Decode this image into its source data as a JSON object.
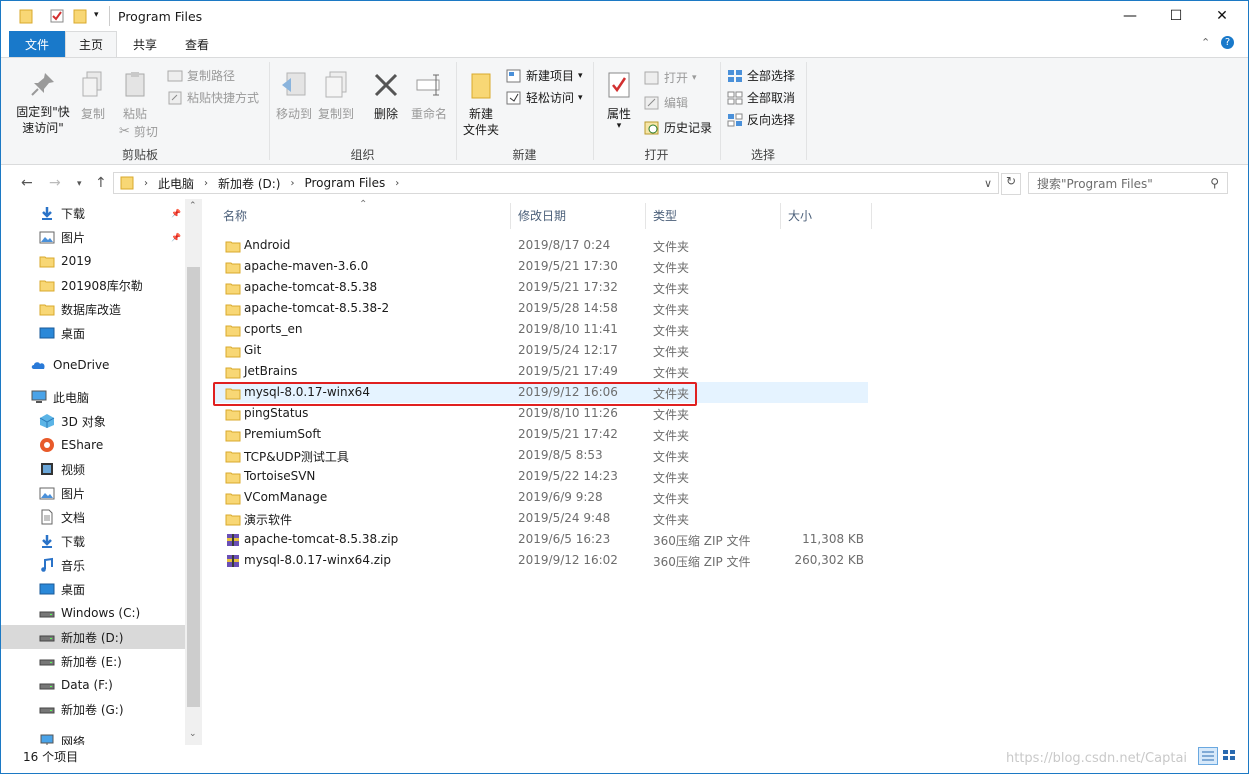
{
  "window": {
    "title": "Program Files",
    "minimize": "—",
    "maximize": "☐",
    "close": "✕"
  },
  "ribbon_tabs": {
    "file": "文件",
    "home": "主页",
    "share": "共享",
    "view": "查看"
  },
  "ribbon": {
    "clipboard": {
      "label": "剪贴板",
      "pin_line1": "固定到\"快",
      "pin_line2": "速访问\"",
      "copy": "复制",
      "paste": "粘贴",
      "cut": "剪切",
      "copy_path": "复制路径",
      "paste_shortcut": "粘贴快捷方式"
    },
    "organize": {
      "label": "组织",
      "move_to": "移动到",
      "copy_to": "复制到",
      "delete": "删除",
      "rename": "重命名"
    },
    "new": {
      "label": "新建",
      "new_folder_line1": "新建",
      "new_folder_line2": "文件夹",
      "new_item": "新建项目",
      "easy_access": "轻松访问"
    },
    "open": {
      "label": "打开",
      "properties": "属性",
      "open": "打开",
      "edit": "编辑",
      "history": "历史记录"
    },
    "select": {
      "label": "选择",
      "select_all": "全部选择",
      "select_none": "全部取消",
      "invert": "反向选择"
    }
  },
  "address": {
    "crumbs": [
      "此电脑",
      "新加卷 (D:)",
      "Program Files"
    ],
    "search_placeholder": "搜索\"Program Files\""
  },
  "nav": {
    "items": [
      {
        "label": "下载",
        "icon": "download-arrow-icon",
        "pinned": true
      },
      {
        "label": "图片",
        "icon": "pictures-icon",
        "pinned": true
      },
      {
        "label": "2019",
        "icon": "folder-icon",
        "pinned": false
      },
      {
        "label": "201908库尔勒",
        "icon": "folder-icon",
        "pinned": false
      },
      {
        "label": "数据库改造",
        "icon": "folder-icon",
        "pinned": false
      },
      {
        "label": "桌面",
        "icon": "desktop-icon",
        "pinned": false
      },
      {
        "label": "OneDrive",
        "icon": "cloud-icon",
        "pinned": false
      },
      {
        "label": "此电脑",
        "icon": "computer-icon",
        "pinned": false
      },
      {
        "label": "3D 对象",
        "icon": "cube-icon",
        "pinned": false
      },
      {
        "label": "EShare",
        "icon": "eshare-icon",
        "pinned": false
      },
      {
        "label": "视频",
        "icon": "video-icon",
        "pinned": false
      },
      {
        "label": "图片",
        "icon": "pictures-icon",
        "pinned": false
      },
      {
        "label": "文档",
        "icon": "document-icon",
        "pinned": false
      },
      {
        "label": "下载",
        "icon": "download-arrow-icon",
        "pinned": false
      },
      {
        "label": "音乐",
        "icon": "music-icon",
        "pinned": false
      },
      {
        "label": "桌面",
        "icon": "desktop-icon",
        "pinned": false
      },
      {
        "label": "Windows (C:)",
        "icon": "drive-icon",
        "pinned": false
      },
      {
        "label": "新加卷 (D:)",
        "icon": "drive-icon",
        "pinned": false,
        "selected": true
      },
      {
        "label": "新加卷 (E:)",
        "icon": "drive-icon",
        "pinned": false
      },
      {
        "label": "Data (F:)",
        "icon": "drive-icon",
        "pinned": false
      },
      {
        "label": "新加卷 (G:)",
        "icon": "drive-icon",
        "pinned": false
      },
      {
        "label": "网络",
        "icon": "network-icon",
        "pinned": false
      }
    ]
  },
  "columns": {
    "name": "名称",
    "date": "修改日期",
    "type": "类型",
    "size": "大小"
  },
  "files": [
    {
      "name": "Android",
      "date": "2019/8/17 0:24",
      "type": "文件夹",
      "size": "",
      "icon": "folder-icon"
    },
    {
      "name": "apache-maven-3.6.0",
      "date": "2019/5/21 17:30",
      "type": "文件夹",
      "size": "",
      "icon": "folder-icon"
    },
    {
      "name": "apache-tomcat-8.5.38",
      "date": "2019/5/21 17:32",
      "type": "文件夹",
      "size": "",
      "icon": "folder-icon"
    },
    {
      "name": "apache-tomcat-8.5.38-2",
      "date": "2019/5/28 14:58",
      "type": "文件夹",
      "size": "",
      "icon": "folder-icon"
    },
    {
      "name": "cports_en",
      "date": "2019/8/10 11:41",
      "type": "文件夹",
      "size": "",
      "icon": "folder-icon"
    },
    {
      "name": "Git",
      "date": "2019/5/24 12:17",
      "type": "文件夹",
      "size": "",
      "icon": "folder-icon"
    },
    {
      "name": "JetBrains",
      "date": "2019/5/21 17:49",
      "type": "文件夹",
      "size": "",
      "icon": "folder-icon"
    },
    {
      "name": "mysql-8.0.17-winx64",
      "date": "2019/9/12 16:06",
      "type": "文件夹",
      "size": "",
      "icon": "folder-icon",
      "highlighted": true
    },
    {
      "name": "pingStatus",
      "date": "2019/8/10 11:26",
      "type": "文件夹",
      "size": "",
      "icon": "folder-icon"
    },
    {
      "name": "PremiumSoft",
      "date": "2019/5/21 17:42",
      "type": "文件夹",
      "size": "",
      "icon": "folder-icon"
    },
    {
      "name": "TCP&UDP测试工具",
      "date": "2019/8/5 8:53",
      "type": "文件夹",
      "size": "",
      "icon": "folder-icon"
    },
    {
      "name": "TortoiseSVN",
      "date": "2019/5/22 14:23",
      "type": "文件夹",
      "size": "",
      "icon": "folder-icon"
    },
    {
      "name": "VComManage",
      "date": "2019/6/9 9:28",
      "type": "文件夹",
      "size": "",
      "icon": "folder-icon"
    },
    {
      "name": "演示软件",
      "date": "2019/5/24 9:48",
      "type": "文件夹",
      "size": "",
      "icon": "folder-icon"
    },
    {
      "name": "apache-tomcat-8.5.38.zip",
      "date": "2019/6/5 16:23",
      "type": "360压缩 ZIP 文件",
      "size": "11,308 KB",
      "icon": "zip-archive-icon"
    },
    {
      "name": "mysql-8.0.17-winx64.zip",
      "date": "2019/9/12 16:02",
      "type": "360压缩 ZIP 文件",
      "size": "260,302 KB",
      "icon": "zip-archive-icon"
    }
  ],
  "status": {
    "item_count": "16 个项目"
  },
  "watermark": "https://blog.csdn.net/Captai",
  "colors": {
    "accent": "#1979ca",
    "highlight_row": "#e5f3ff",
    "annotation_box": "#e02020",
    "folder": "#f8d775"
  }
}
